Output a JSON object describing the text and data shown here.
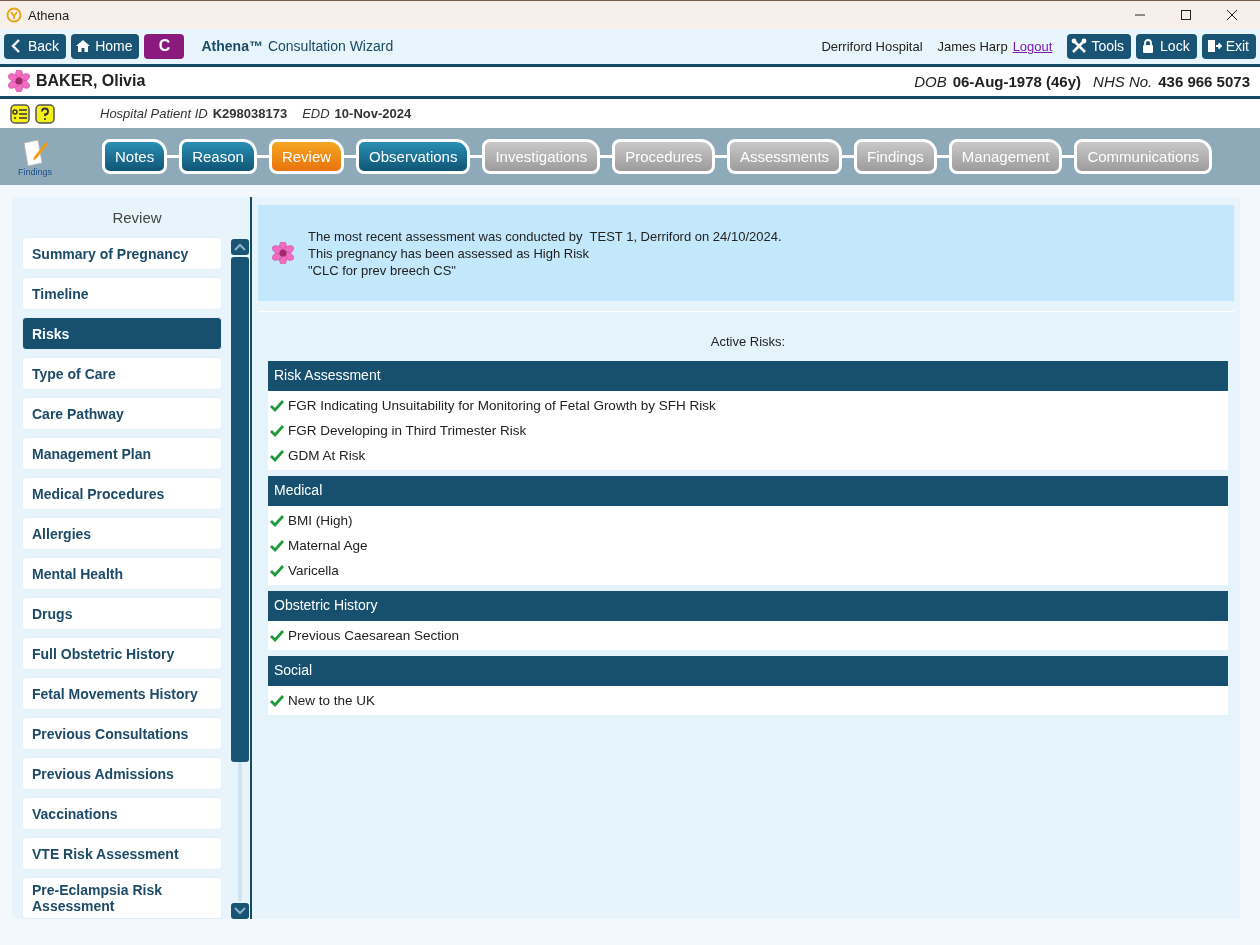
{
  "window": {
    "title": "Athena"
  },
  "toolbar": {
    "back": "Back",
    "home": "Home",
    "badge": "C",
    "app_name": "Athena™",
    "app_subtitle": "Consultation Wizard",
    "location": "Derriford Hospital",
    "user": "James Harp",
    "logout": "Logout",
    "tools": "Tools",
    "lock": "Lock",
    "exit": "Exit"
  },
  "patient": {
    "name": "BAKER, Olivia",
    "dob_label": "DOB",
    "dob": "06-Aug-1978 (46y)",
    "nhs_label": "NHS No.",
    "nhs": "436 966 5073"
  },
  "info": {
    "id_label": "Hospital Patient ID",
    "id": "K298038173",
    "edd_label": "EDD",
    "edd": "10-Nov-2024"
  },
  "wizard": {
    "icon_label": "Findings",
    "steps": [
      {
        "label": "Notes",
        "selected": false,
        "completed": true
      },
      {
        "label": "Reason",
        "selected": false,
        "completed": true
      },
      {
        "label": "Review",
        "selected": true,
        "completed": false
      },
      {
        "label": "Observations",
        "selected": false,
        "completed": true
      },
      {
        "label": "Investigations",
        "selected": false,
        "completed": false
      },
      {
        "label": "Procedures",
        "selected": false,
        "completed": false
      },
      {
        "label": "Assessments",
        "selected": false,
        "completed": false
      },
      {
        "label": "Findings",
        "selected": false,
        "completed": false
      },
      {
        "label": "Management",
        "selected": false,
        "completed": false
      },
      {
        "label": "Communications",
        "selected": false,
        "completed": false
      }
    ]
  },
  "sidebar": {
    "title": "Review",
    "items": [
      {
        "label": "Summary of Pregnancy",
        "selected": false
      },
      {
        "label": "Timeline",
        "selected": false
      },
      {
        "label": "Risks",
        "selected": true
      },
      {
        "label": "Type of Care",
        "selected": false
      },
      {
        "label": "Care Pathway",
        "selected": false
      },
      {
        "label": "Management Plan",
        "selected": false
      },
      {
        "label": "Medical Procedures",
        "selected": false
      },
      {
        "label": "Allergies",
        "selected": false
      },
      {
        "label": "Mental Health",
        "selected": false
      },
      {
        "label": "Drugs",
        "selected": false
      },
      {
        "label": "Full Obstetric History",
        "selected": false
      },
      {
        "label": "Fetal Movements History",
        "selected": false
      },
      {
        "label": "Previous Consultations",
        "selected": false
      },
      {
        "label": "Previous Admissions",
        "selected": false
      },
      {
        "label": "Vaccinations",
        "selected": false
      },
      {
        "label": "VTE Risk Assessment",
        "selected": false
      },
      {
        "label": "Pre-Eclampsia Risk Assessment",
        "selected": false
      }
    ]
  },
  "alert": {
    "lines": [
      "The most recent assessment was conducted by  TEST 1, Derriford on 24/10/2024.",
      "This pregnancy has been assessed as High Risk",
      "\"CLC for prev breech CS\""
    ]
  },
  "risks": {
    "title": "Active Risks:",
    "groups": [
      {
        "heading": "Risk Assessment",
        "items": [
          "FGR Indicating Unsuitability for Monitoring of Fetal Growth by SFH Risk",
          "FGR Developing in Third Trimester Risk",
          "GDM At Risk"
        ]
      },
      {
        "heading": "Medical",
        "items": [
          "BMI (High)",
          "Maternal Age",
          "Varicella"
        ]
      },
      {
        "heading": "Obstetric History",
        "items": [
          "Previous Caesarean Section"
        ]
      },
      {
        "heading": "Social",
        "items": [
          "New to the UK"
        ]
      }
    ]
  }
}
